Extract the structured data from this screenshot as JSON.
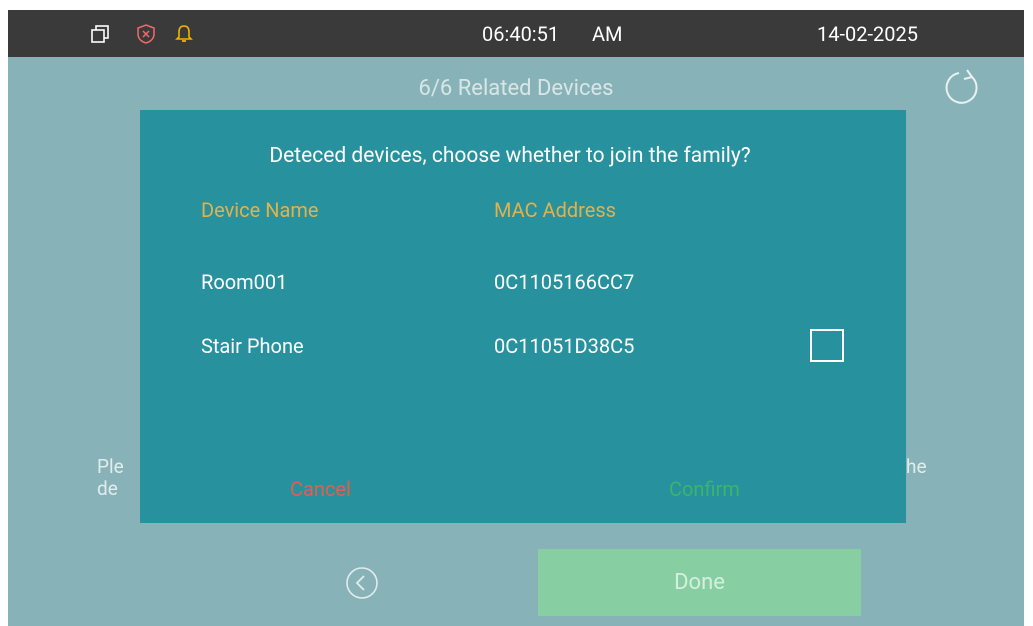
{
  "status_bar": {
    "time": "06:40:51",
    "ampm": "AM",
    "date": "14-02-2025",
    "icons": [
      "window-restore-icon",
      "shield-x-icon",
      "bell-icon"
    ],
    "bell_color": "#f2b200"
  },
  "page": {
    "title": "6/6 Related Devices",
    "hint_left_line1": "Ple",
    "hint_left_line2": "de",
    "hint_right_line1": "he",
    "done_label": "Done"
  },
  "dialog": {
    "title": "Deteced devices, choose whether to join the family?",
    "columns": [
      "Device Name",
      "MAC Address"
    ],
    "devices": [
      {
        "name": "Room001",
        "mac": "0C1105166CC7",
        "has_checkbox": false
      },
      {
        "name": "Stair Phone",
        "mac": "0C11051D38C5",
        "has_checkbox": true,
        "checked": false
      }
    ],
    "cancel_label": "Cancel",
    "confirm_label": "Confirm"
  },
  "colors": {
    "background": "#87b3b8",
    "dialog": "#27919e",
    "column_header": "#e0b24e",
    "cancel": "#e05f4e",
    "confirm": "#3ab56a",
    "done_button": "#87cfa2"
  }
}
